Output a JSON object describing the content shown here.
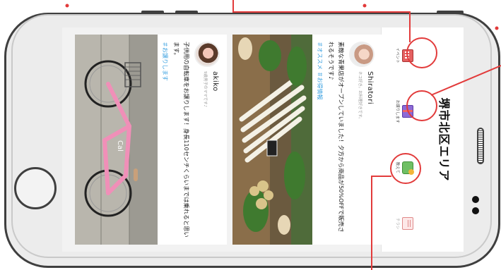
{
  "app": {
    "title": "堺市北区エリア"
  },
  "tabs": [
    {
      "id": "event",
      "label": "イベント",
      "icon": "calendar-icon"
    },
    {
      "id": "gift",
      "label": "お譲りします",
      "icon": "gift-icon"
    },
    {
      "id": "teach",
      "label": "教えて",
      "icon": "question-icon"
    },
    {
      "id": "flyer",
      "label": "チラシ",
      "icon": "flyer-icon"
    }
  ],
  "posts": [
    {
      "username": "Shiratori",
      "user_sub": "ネコ好き。お料理好きです。",
      "body": "素敵な青果店がオープンしていました！夕方から商品が50%OFFで販売されるそうです♪",
      "hashtags": "＃オススメ ＃お得情報",
      "photo": "vegetable-market-photo"
    },
    {
      "username": "akiko",
      "user_sub": "9歳男子のママです♪",
      "body": "子供用の自転車をお譲りします！身長110センチくらいまでは乗れると思います。",
      "hashtags": "＃お譲りします",
      "photo": "pink-bicycle-photo"
    }
  ],
  "colors": {
    "highlight": "#e23b3b",
    "hashtag": "#3aa0e0",
    "phone_frame": "#3f3f3f"
  }
}
